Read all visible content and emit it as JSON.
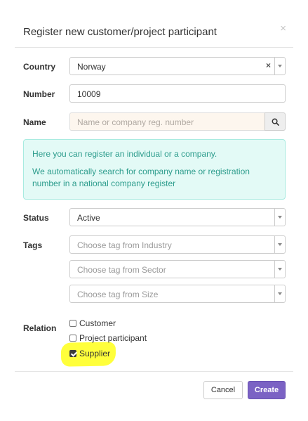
{
  "modal": {
    "title": "Register new customer/project participant",
    "close_glyph": "×"
  },
  "form": {
    "country": {
      "label": "Country",
      "value": "Norway",
      "clear_glyph": "×"
    },
    "number": {
      "label": "Number",
      "value": "10009"
    },
    "name": {
      "label": "Name",
      "placeholder": "Name or company reg. number"
    },
    "info": {
      "line1": "Here you can register an individual or a company.",
      "line2": "We automatically search for company name or registration number in a national company register"
    },
    "status": {
      "label": "Status",
      "value": "Active"
    },
    "tags": {
      "label": "Tags",
      "industry_placeholder": "Choose tag from Industry",
      "sector_placeholder": "Choose tag from Sector",
      "size_placeholder": "Choose tag from Size"
    },
    "relation": {
      "label": "Relation",
      "options": [
        {
          "label": "Customer",
          "checked": false
        },
        {
          "label": "Project participant",
          "checked": false
        },
        {
          "label": "Supplier",
          "checked": true
        }
      ]
    }
  },
  "footer": {
    "cancel_label": "Cancel",
    "create_label": "Create"
  },
  "colors": {
    "primary": "#7b62c4",
    "info_bg": "#e3faf6",
    "info_text": "#2c9c8c",
    "highlight": "#ffff3b"
  }
}
